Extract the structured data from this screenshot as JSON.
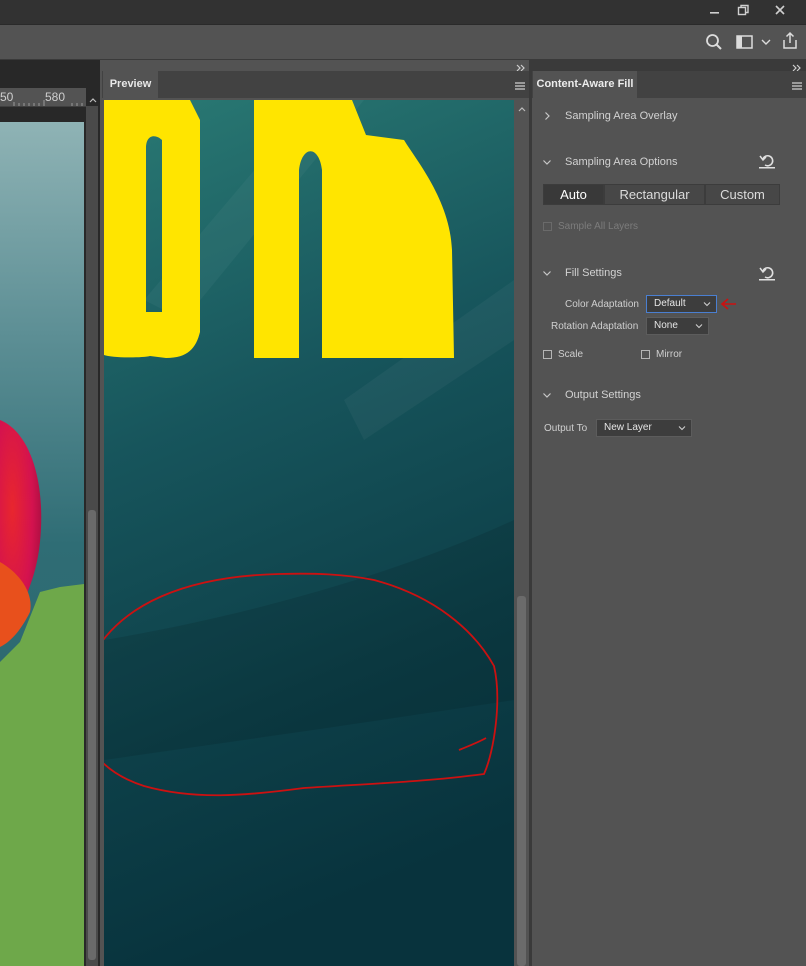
{
  "ruler": {
    "left_value": "50",
    "right_value": "580"
  },
  "preview_panel": {
    "tab_label": "Preview"
  },
  "content_aware_fill": {
    "tab_label": "Content-Aware Fill",
    "sampling_area_overlay": {
      "label": "Sampling Area Overlay",
      "expanded": false
    },
    "sampling_area_options": {
      "label": "Sampling Area Options",
      "buttons": [
        "Auto",
        "Rectangular",
        "Custom"
      ],
      "selected": "Auto",
      "sample_all_layers": {
        "label": "Sample All Layers",
        "checked": false,
        "enabled": false
      }
    },
    "fill_settings": {
      "label": "Fill Settings",
      "color_adaptation": {
        "label": "Color Adaptation",
        "value": "Default"
      },
      "rotation_adaptation": {
        "label": "Rotation Adaptation",
        "value": "None"
      },
      "scale": {
        "label": "Scale",
        "checked": false
      },
      "mirror": {
        "label": "Mirror",
        "checked": false
      }
    },
    "output_settings": {
      "label": "Output Settings",
      "output_to": {
        "label": "Output To",
        "value": "New Layer"
      }
    }
  },
  "colors": {
    "accent_text": "#ffe500",
    "annotation": "#cc1111",
    "panel_bg": "#535353",
    "preview_bg": "#0f4a52"
  },
  "icons": [
    "minimize-icon",
    "restore-icon",
    "close-icon",
    "search-icon",
    "workspace-icon",
    "share-icon",
    "panel-menu-icon",
    "reset-icon",
    "chevron-right-icon",
    "chevron-down-icon"
  ]
}
